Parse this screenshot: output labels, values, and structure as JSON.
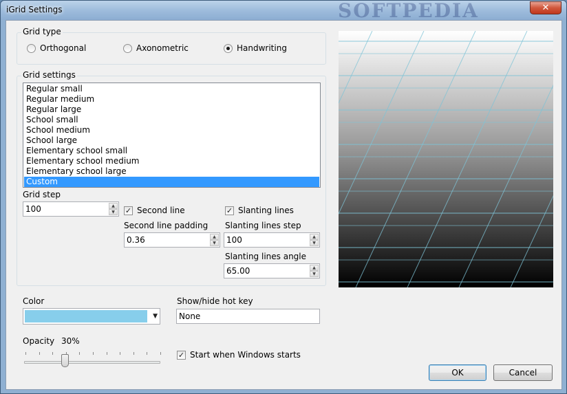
{
  "window": {
    "title": "iGrid Settings",
    "watermark": "SOFTPEDIA",
    "close_glyph": "✕"
  },
  "grid_type": {
    "label": "Grid type",
    "options": [
      {
        "label": "Orthogonal",
        "selected": false
      },
      {
        "label": "Axonometric",
        "selected": false
      },
      {
        "label": "Handwriting",
        "selected": true
      }
    ]
  },
  "grid_settings": {
    "label": "Grid settings",
    "items": [
      "Regular small",
      "Regular medium",
      "Regular large",
      "School small",
      "School medium",
      "School large",
      "Elementary school small",
      "Elementary school medium",
      "Elementary school large",
      "Custom"
    ],
    "selected_index": 9,
    "grid_step_label": "Grid step",
    "grid_step_value": "100",
    "second_line_label": "Second line",
    "second_line_checked": true,
    "second_line_padding_label": "Second line padding",
    "second_line_padding_value": "0.36",
    "slanting_lines_label": "Slanting lines",
    "slanting_lines_checked": true,
    "slanting_lines_step_label": "Slanting lines step",
    "slanting_lines_step_value": "100",
    "slanting_lines_angle_label": "Slanting lines angle",
    "slanting_lines_angle_value": "65.00"
  },
  "color": {
    "label": "Color",
    "value": "#87ceeb"
  },
  "hotkey": {
    "label": "Show/hide hot key",
    "value": "None"
  },
  "opacity": {
    "label": "Opacity",
    "value_text": "30%",
    "fraction": 0.3
  },
  "startup": {
    "label": "Start when Windows starts",
    "checked": true
  },
  "buttons": {
    "ok": "OK",
    "cancel": "Cancel"
  },
  "preview": {
    "line_color": "#7ec3d6"
  },
  "icons": {
    "check": "✓",
    "spin_up": "▲",
    "spin_down": "▼",
    "combo_arrow": "▼"
  }
}
